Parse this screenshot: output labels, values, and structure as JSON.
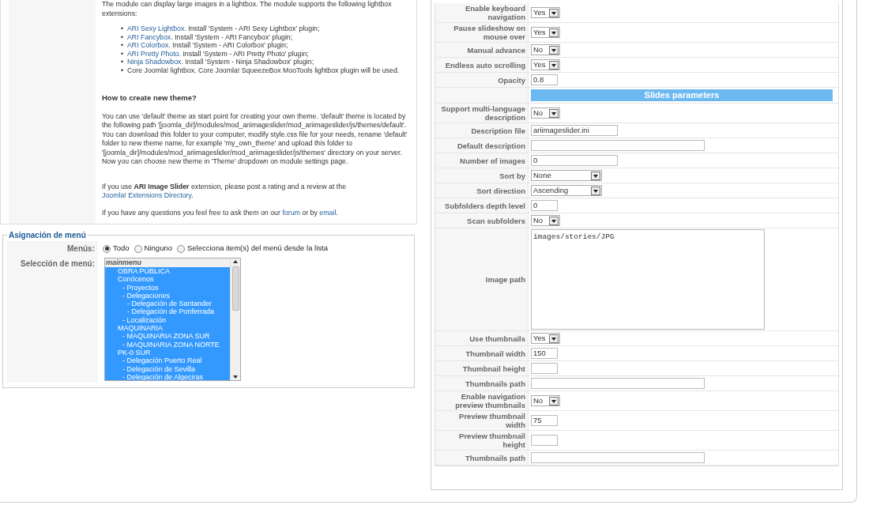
{
  "description": {
    "intro": "The module can display large images in a lightbox. The module supports the following lightbox extensions:",
    "lightboxes": [
      {
        "bullet": "•",
        "link": "ARI Sexy Lightbox.",
        "text": " Install 'System - ARI Sexy Lightbox' plugin;"
      },
      {
        "bullet": "•",
        "link": "ARI Fancybox.",
        "text": " Install 'System - ARI Fancybox' plugin;"
      },
      {
        "bullet": "•",
        "link": "ARI Colorbox.",
        "text": " Install 'System - ARI Colorbox' plugin;"
      },
      {
        "bullet": "•",
        "link": "ARI Pretty Photo.",
        "text": " Install 'System - ARI Pretty Photo' plugin;"
      },
      {
        "bullet": "•",
        "link": "Ninja Shadowbox.",
        "text": " Install 'System - Ninja Shadowbox' plugin;"
      },
      {
        "bullet": "•",
        "text": "Core Joomla! lightbox. Core Joomla! SqueezeBox MooTools lightbox plugin will be used."
      }
    ],
    "heading": "How to create new theme?",
    "paragraph": "You can use 'default' theme as start point for creating your own theme. 'default' theme is located by the following path '[joomla_dir]/modules/mod_ariimageslider/mod_ariimageslider/js/themes/default'. You can download this folder to your computer, modify style.css file for your needs, rename 'default' folder to new theme name, for example 'my_own_theme' and upload this folder to '[joomla_dir]/modules/mod_ariimageslider/mod_ariimageslider/js/themes' directory on your server. Now you can choose new theme in 'Theme' dropdown on module settings page.",
    "rating_text": "If you use **ARI Image Slider** extension, please post a rating and a review at the ",
    "rating_link": "Joomla! Extensions Directory",
    "rating_end": ".",
    "questions_text": "If you have any questions you feel free to ask them on our ",
    "forum_link": "forum",
    "questions_mid": " or by ",
    "email_link": "email",
    "questions_end": "."
  },
  "menu_assignment": {
    "legend": "Asignación de menú",
    "menus_label": "Menús:",
    "radios": [
      {
        "label": "Todo",
        "selected": true
      },
      {
        "label": "Ninguno",
        "selected": false
      },
      {
        "label": "Selecciona item(s) del menú desde la lista",
        "selected": false
      }
    ],
    "selection_label": "Selección de menú:",
    "list_header": "mainmenu",
    "items": [
      {
        "label": "OBRA PÚBLICA",
        "selected": true
      },
      {
        "label": "Conócenos",
        "selected": true,
        "children": [
          {
            "label": "- Proyectos",
            "selected": true
          },
          {
            "label": "- Delegaciones",
            "selected": true,
            "children": [
              {
                "label": "- Delegación de Santander",
                "selected": true
              },
              {
                "label": "- Delegación de Ponferrada",
                "selected": true
              }
            ]
          },
          {
            "label": "- Localización",
            "selected": true
          }
        ]
      },
      {
        "label": "MAQUINARIA",
        "selected": true,
        "children": [
          {
            "label": "- MAQUINARIA ZONA SUR",
            "selected": true
          },
          {
            "label": "- MAQUINARIA ZONA NORTE",
            "selected": true
          }
        ]
      },
      {
        "label": "PK-0 SUR",
        "selected": true,
        "children": [
          {
            "label": "- Delegación Puerto Real",
            "selected": true
          },
          {
            "label": "- Delegación de Sevilla",
            "selected": true
          },
          {
            "label": "- Delegación de Algeciras",
            "selected": true
          }
        ]
      }
    ]
  },
  "params": [
    {
      "kind": "toggle",
      "label": "Enable keyboard navigation",
      "value": "Yes"
    },
    {
      "kind": "toggle",
      "label": "Pause slideshow on mouse over",
      "value": "Yes"
    },
    {
      "kind": "toggle",
      "label": "Manual advance",
      "value": "No"
    },
    {
      "kind": "toggle",
      "label": "Endless auto scrolling",
      "value": "Yes"
    },
    {
      "kind": "number",
      "label": "Opacity",
      "value": "0.8"
    },
    {
      "kind": "header",
      "label": "Slides parameters"
    },
    {
      "kind": "toggle",
      "label": "Support multi-language description",
      "value": "No"
    },
    {
      "kind": "text",
      "label": "Description file",
      "value": "ariimageslider.ini"
    },
    {
      "kind": "wide",
      "label": "Default description"
    },
    {
      "kind": "text",
      "label": "Number of images",
      "value": "0"
    },
    {
      "kind": "select",
      "label": "Sort by",
      "value": "None"
    },
    {
      "kind": "select",
      "label": "Sort direction",
      "value": "Ascending"
    },
    {
      "kind": "number",
      "label": "Subfolders depth level",
      "value": "0"
    },
    {
      "kind": "toggle",
      "label": "Scan subfolders",
      "value": "No"
    },
    {
      "kind": "textarea",
      "label": "Image path",
      "value": "images/stories/JPG"
    },
    {
      "kind": "toggle",
      "label": "Use thumbnails",
      "value": "Yes"
    },
    {
      "kind": "number",
      "label": "Thumbnail width",
      "value": "150"
    },
    {
      "kind": "number",
      "label": "Thumbnail height"
    },
    {
      "kind": "wide",
      "label": "Thumbnails path"
    },
    {
      "kind": "toggle",
      "label": "Enable navigation preview thumbnails",
      "value": "No"
    },
    {
      "kind": "number",
      "label": "Preview thumbnail width",
      "value": "75"
    },
    {
      "kind": "number",
      "label": "Preview thumbnail height"
    },
    {
      "kind": "wide",
      "label": "Thumbnails path"
    }
  ]
}
